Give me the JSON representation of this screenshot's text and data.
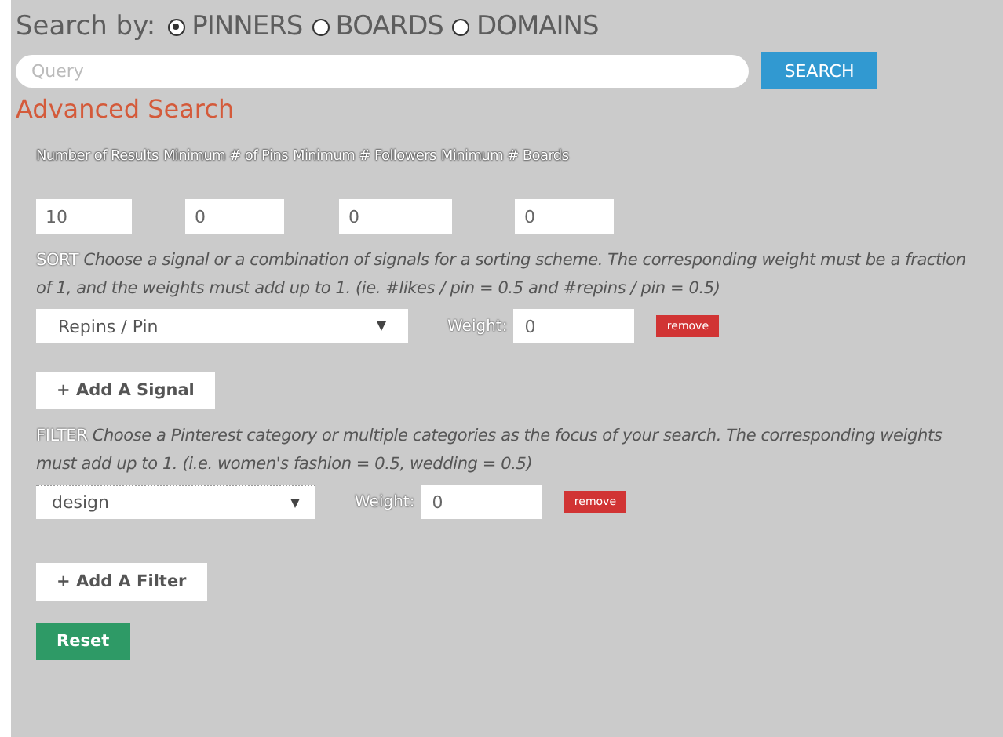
{
  "search_by": {
    "label": "Search by:",
    "options": [
      {
        "label": "PINNERS",
        "selected": true
      },
      {
        "label": "BOARDS",
        "selected": false
      },
      {
        "label": "DOMAINS",
        "selected": false
      }
    ]
  },
  "query": {
    "placeholder": "Query"
  },
  "search_button": "SEARCH",
  "advanced_title": "Advanced Search",
  "minimums": [
    {
      "label": "Number of Results",
      "value": "10"
    },
    {
      "label": "Minimum # of Pins",
      "value": "0"
    },
    {
      "label": "Minimum # Followers",
      "value": "0"
    },
    {
      "label": "Minimum # Boards",
      "value": "0"
    }
  ],
  "sort": {
    "tag": "SORT",
    "help": "Choose a signal or a combination of signals for a sorting scheme. The corresponding weight must be a fraction of 1, and the weights must add up to 1. (ie. #likes / pin = 0.5 and #repins / pin = 0.5)",
    "select": "Repins / Pin",
    "weight_label": "Weight:",
    "weight": "0",
    "remove": "remove",
    "add": "+ Add A Signal"
  },
  "filter": {
    "tag": "FILTER",
    "help": "Choose a Pinterest category or multiple categories as the focus of your search. The corresponding weights must add up to 1. (i.e. women's fashion = 0.5, wedding = 0.5)",
    "select": "design",
    "weight_label": "Weight:",
    "weight": "0",
    "remove": "remove",
    "add": "+ Add A Filter"
  },
  "reset": "Reset"
}
